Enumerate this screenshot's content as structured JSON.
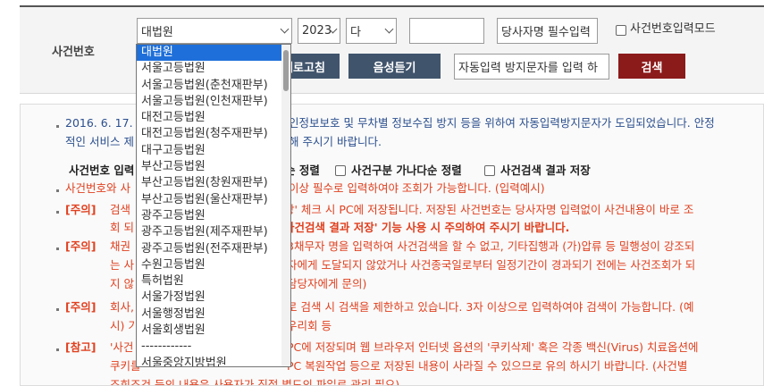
{
  "search": {
    "label": "사건번호",
    "court_select": "대법원",
    "year_select": "2023",
    "type_select": "다",
    "number_input": "",
    "party_name_input": "당사자명 필수입력",
    "manual_input_label": "사건번호입력모드",
    "refresh_button": "새로고침",
    "audio_button": "음성듣기",
    "captcha_input": "자동입력 방지문자를 입력 하",
    "search_button": "검색"
  },
  "colors": {
    "dark_button": "#40546c",
    "search_button": "#8b1a1a",
    "link_blue": "#2b4f8e",
    "warning_red": "#e0401f"
  },
  "dropdown": {
    "options": [
      "대법원",
      "서울고등법원",
      "서울고등법원(춘천재판부)",
      "서울고등법원(인천재판부)",
      "대전고등법원",
      "대전고등법원(청주재판부)",
      "대구고등법원",
      "부산고등법원",
      "부산고등법원(창원재판부)",
      "부산고등법원(울산재판부)",
      "광주고등법원",
      "광주고등법원(제주재판부)",
      "광주고등법원(전주재판부)",
      "수원고등법원",
      "특허법원",
      "서울가정법원",
      "서울행정법원",
      "서울회생법원",
      "------------",
      "서울중앙지방법원"
    ]
  },
  "notice": {
    "l1": "2016. 6. 17. -",
    "l1b": "인정보보호 및 무차별 정보수집 방지 등을 위하여 자동입력방지문자가 도입되었습니다. 안정",
    "l2": "적인 서비스 제",
    "l2b": "해 주시기 바랍니다.",
    "opt_label": "사건번호 입력",
    "opt1": "순 정렬",
    "opt2": "사건구분 가나다순 정렬",
    "opt3": "사건검색 결과 저장",
    "l4a": "사건번호와 사",
    "l4b": "이상 필수로 입력하여야 조회가 가능합니다. (입력예시)",
    "tag_caution": "[주의]",
    "tag_ref": "[참고]",
    "l5a": "검색",
    "l5b": "장' 체크 시 PC에 저장됩니다. 저장된 사건번호는 당사자명 입력없이 사건내용이 바로 조",
    "l6a": "회 되",
    "l6b": "사건검색 결과 저장' 기능 사용 시 주의하여 주시기 바랍니다.",
    "l7a": "채권",
    "l7b": "3채무자 명을 입력하여 사건검색을 할 수 없고, 기타집행과 (가)압류 등 밀행성이 강조되",
    "l8a": "는 사",
    "l8b": "자에게 도달되지 않았거나 사건종국일로부터 일정기간이 경과되기 전에는 사건조회가 되",
    "l9a": "지 않",
    "l9b": "담당자에게 문의)",
    "l10a": "회사,",
    "l10b": "로 검색 시 검색을 제한하고 있습니다. 3자 이상으로 입력하여야 검색이 가능합니다. (예",
    "l11a": "시) 기",
    "l11b": "우리회 등",
    "l12a": "'사건",
    "l12b": "PC에 저장되며 웹 브라우저 인터넷 옵션의 '쿠키삭제' 혹은 각종 백신(Virus) 치료옵션에",
    "l13a": "쿠키를",
    "l13b": "PC 복원작업 등으로 저장된 내용이 사라질 수 있으므로 유의 하시기 바랍니다. (사건별",
    "l14": "조회조건 등의 내용은 사용자가 직접 별도의 파일로 관리 필요)"
  }
}
